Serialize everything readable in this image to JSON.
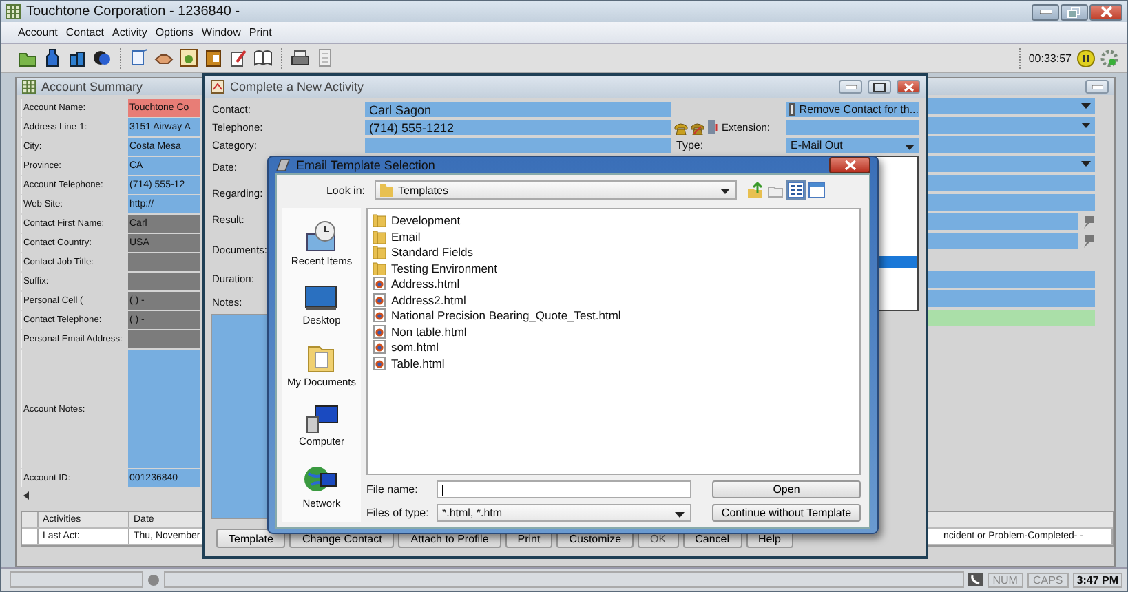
{
  "main_window": {
    "title": "Touchtone Corporation - 1236840 -",
    "menu": [
      "Account",
      "Contact",
      "Activity",
      "Options",
      "Window",
      "Print"
    ],
    "timer": "00:33:57"
  },
  "account_summary": {
    "title": "Account Summary",
    "fields": [
      {
        "label": "Account Name:",
        "value": "Touchtone Co",
        "kind": "required"
      },
      {
        "label": "Address Line-1:",
        "value": "3151 Airway A",
        "kind": "editable"
      },
      {
        "label": "City:",
        "value": "Costa Mesa",
        "kind": "editable"
      },
      {
        "label": "Province:",
        "value": "CA",
        "kind": "editable"
      },
      {
        "label": "Account Telephone:",
        "value": "(714) 555-12",
        "kind": "editable"
      },
      {
        "label": "Web Site:",
        "value": "http://",
        "kind": "editable"
      },
      {
        "label": "Contact First Name:",
        "value": "Carl",
        "kind": "readonly"
      },
      {
        "label": "Contact Country:",
        "value": "USA",
        "kind": "readonly"
      },
      {
        "label": "Contact Job Title:",
        "kind": "readonly"
      },
      {
        "label": "Suffix:",
        "kind": "readonly"
      },
      {
        "label": "Personal Cell (",
        "value": "(  )   -",
        "kind": "readonly"
      },
      {
        "label": "Contact Telephone:",
        "value": "(  )   -",
        "kind": "readonly"
      },
      {
        "label": "Personal Email Address:",
        "kind": "readonly"
      },
      {
        "label": "Account Notes:",
        "kind": "notes"
      },
      {
        "label": "Account ID:",
        "value": "001236840",
        "kind": "editable"
      }
    ]
  },
  "activity_table": {
    "columns": [
      "Activities",
      "Date"
    ],
    "rows": [
      {
        "cells": [
          "Last Act:",
          "Thu, November",
          "ncident or Problem-Completed- -"
        ]
      }
    ]
  },
  "activity_dialog": {
    "title": "Complete a New Activity",
    "fields": [
      {
        "label": "Contact:",
        "value": "Carl Sagon"
      },
      {
        "label": "Telephone:",
        "value": "(714) 555-1212"
      },
      {
        "label": "Category:"
      },
      {
        "label": "Date:"
      },
      {
        "label": "Regarding:"
      },
      {
        "label": "Result:"
      },
      {
        "label": "Documents:"
      },
      {
        "label": "Duration:"
      },
      {
        "label": "Notes:"
      }
    ],
    "remove_contact": {
      "label": "Remove Contact for th...",
      "checked": false
    },
    "extension_label": "Extension:",
    "type_label": "Type:",
    "type_value": "E-Mail Out",
    "buttons": [
      {
        "label": "Template",
        "disabled": false
      },
      {
        "label": "Change Contact",
        "disabled": false
      },
      {
        "label": "Attach to Profile",
        "disabled": false
      },
      {
        "label": "Print",
        "disabled": false
      },
      {
        "label": "Customize",
        "disabled": false
      },
      {
        "label": "OK",
        "disabled": true
      },
      {
        "label": "Cancel",
        "disabled": false
      },
      {
        "label": "Help",
        "disabled": false
      }
    ]
  },
  "email_dialog": {
    "title": "Email Template Selection",
    "look_in_label": "Look in:",
    "look_in": "Templates",
    "places": [
      {
        "label": "Recent Items",
        "kind": "recent"
      },
      {
        "label": "Desktop",
        "kind": "desktop"
      },
      {
        "label": "My Documents",
        "kind": "documents"
      },
      {
        "label": "Computer",
        "kind": "computer"
      },
      {
        "label": "Network",
        "kind": "network"
      }
    ],
    "files": [
      {
        "name": "Development",
        "kind": "folder"
      },
      {
        "name": "Email",
        "kind": "folder"
      },
      {
        "name": "Standard Fields",
        "kind": "folder"
      },
      {
        "name": "Testing Environment",
        "kind": "folder"
      },
      {
        "name": "Address.html",
        "kind": "html"
      },
      {
        "name": "Address2.html",
        "kind": "html"
      },
      {
        "name": "National Precision Bearing_Quote_Test.html",
        "kind": "html"
      },
      {
        "name": "Non table.html",
        "kind": "html"
      },
      {
        "name": "som.html",
        "kind": "html"
      },
      {
        "name": "Table.html",
        "kind": "html"
      }
    ],
    "file_name_label": "File name:",
    "files_of_type_label": "Files of type:",
    "files_of_type": "*.html, *.htm",
    "buttons": [
      "Open",
      "Continue without Template"
    ]
  },
  "status_bar": {
    "indicators": [
      "NUM",
      "CAPS"
    ],
    "time": "3:47 PM"
  }
}
